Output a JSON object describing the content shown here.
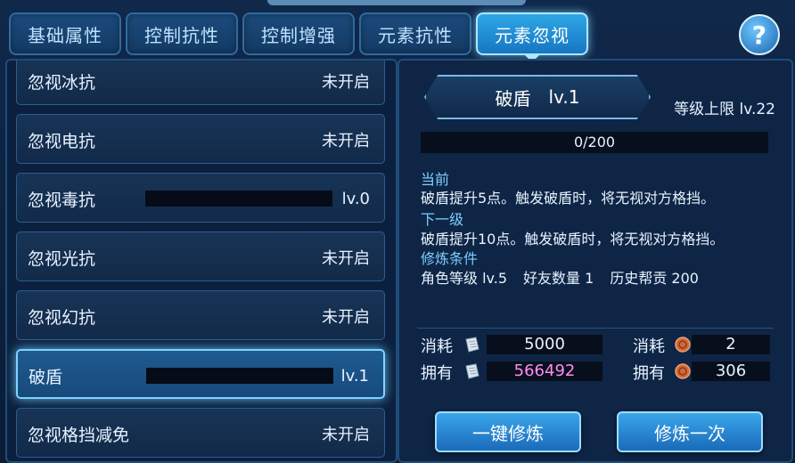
{
  "tabs": [
    {
      "label": "基础属性",
      "active": false
    },
    {
      "label": "控制抗性",
      "active": false
    },
    {
      "label": "控制增强",
      "active": false
    },
    {
      "label": "元素抗性",
      "active": false
    },
    {
      "label": "元素忽视",
      "active": true
    }
  ],
  "help_label": "?",
  "list": [
    {
      "name": "忽视冰抗",
      "status": "未开启"
    },
    {
      "name": "忽视电抗",
      "status": "未开启"
    },
    {
      "name": "忽视毒抗",
      "status": "lv.0"
    },
    {
      "name": "忽视光抗",
      "status": "未开启"
    },
    {
      "name": "忽视幻抗",
      "status": "未开启"
    },
    {
      "name": "破盾",
      "status": "lv.1"
    },
    {
      "name": "忽视格挡减免",
      "status": "未开启"
    }
  ],
  "detail": {
    "name": "破盾",
    "level": "lv.1",
    "limit": "等级上限 lv.22",
    "progress_text": "0/200",
    "progress_fraction": 0,
    "current_label": "当前",
    "current_desc": "破盾提升5点。触发破盾时，将无视对方格挡。",
    "next_label": "下一级",
    "next_desc": "破盾提升10点。触发破盾时，将无视对方格挡。",
    "cond_label": "修炼条件",
    "conditions": [
      "角色等级 lv.5",
      "好友数量 1",
      "历史帮贡 200"
    ]
  },
  "costs": {
    "consume_label": "消耗",
    "own_label": "拥有",
    "scroll_consume": "5000",
    "scroll_own": "566492",
    "coin_consume": "2",
    "coin_own": "306"
  },
  "buttons": {
    "one_click": "一键修炼",
    "once": "修炼一次"
  },
  "colors": {
    "accent": "#2fa7e6",
    "own_highlight": "#ff8cf0",
    "label": "#7ccfff"
  }
}
